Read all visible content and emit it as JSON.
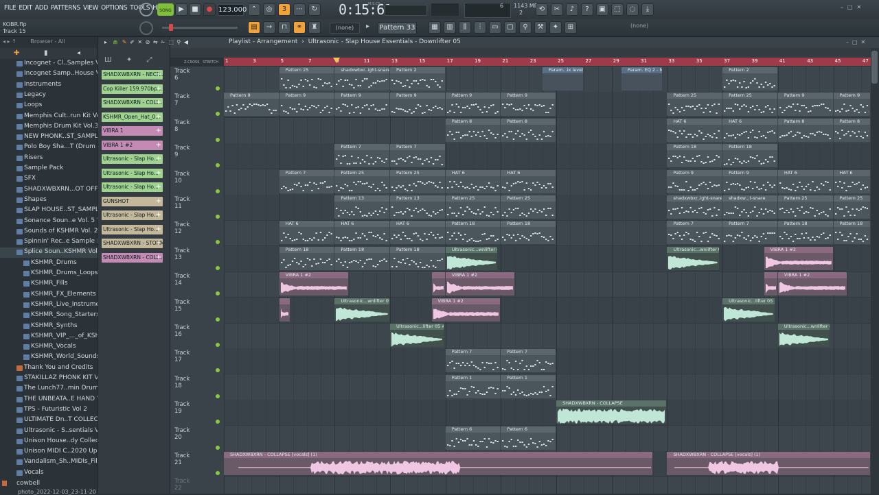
{
  "menu": [
    "FILE",
    "EDIT",
    "ADD",
    "PATTERNS",
    "VIEW",
    "OPTIONS",
    "TOOLS",
    "HELP"
  ],
  "hint": {
    "file": "KOBR.flp",
    "track": "Track 15"
  },
  "transport": {
    "song_label": "SONG",
    "tempo": "123.000",
    "time": "0:15:61",
    "time_unit": "M:S:CS",
    "cpu": "6",
    "mem": "1143 MB",
    "mem2": "2"
  },
  "pattern_selector": "Pattern 33",
  "snap_none": "(none)",
  "snap_none2": "(none)",
  "browser": {
    "header": "Browser - All",
    "items": [
      {
        "label": "Incognet - Cl..Samples Vol.1",
        "indent": 1
      },
      {
        "label": "Incognet Samp..House Vol.3",
        "indent": 1
      },
      {
        "label": "Instruments",
        "indent": 1
      },
      {
        "label": "Legacy",
        "indent": 1
      },
      {
        "label": "Loops",
        "indent": 1
      },
      {
        "label": "Memphis Cult..run Kit Vol.2",
        "indent": 1
      },
      {
        "label": "Memphis Drum Kit Vol.3",
        "indent": 1
      },
      {
        "label": "NEW PHONK..ST_SAMPLES)",
        "indent": 1
      },
      {
        "label": "Polo Boy Sha...T (Drum Kit)",
        "indent": 1
      },
      {
        "label": "Risers",
        "indent": 1
      },
      {
        "label": "Sample Pack",
        "indent": 1
      },
      {
        "label": "SFX",
        "indent": 1
      },
      {
        "label": "SHADXWBXRN...OT OFFICAL)",
        "indent": 1
      },
      {
        "label": "Shapes",
        "indent": 1
      },
      {
        "label": "SLAP HOUSE..ST_SAMPLES)",
        "indent": 1
      },
      {
        "label": "Sonance Soun..e Vol. 5 WAV",
        "indent": 1
      },
      {
        "label": "Sounds of KSHMR Vol. 2",
        "indent": 1
      },
      {
        "label": "Spinnin' Rec..e Sample Pack",
        "indent": 1
      },
      {
        "label": "Splice Soun..KSHMR Vol.3",
        "indent": 1,
        "selected": true
      },
      {
        "label": "KSHMR_Drums",
        "indent": 2
      },
      {
        "label": "KSHMR_Drums_Loops",
        "indent": 2
      },
      {
        "label": "KSHMR_Fills",
        "indent": 2
      },
      {
        "label": "KSHMR_FX_Elements",
        "indent": 2
      },
      {
        "label": "KSHMR_Live_Instruments",
        "indent": 2
      },
      {
        "label": "KSHMR_Song_Starters",
        "indent": 2
      },
      {
        "label": "KSHMR_Synths",
        "indent": 2
      },
      {
        "label": "KSHMR_VIP_..._of_KSHMR",
        "indent": 2
      },
      {
        "label": "KSHMR_Vocals",
        "indent": 2
      },
      {
        "label": "KSHMR_World_Sounds",
        "indent": 2
      },
      {
        "label": "Thank You and Credits",
        "indent": 1,
        "special": true
      },
      {
        "label": "STAKILLAZ PHONK KIT VOL.2",
        "indent": 1
      },
      {
        "label": "The Lunch77..min Drumkit",
        "indent": 1
      },
      {
        "label": "THE UNBEATA..E HAND VOL.3",
        "indent": 1
      },
      {
        "label": "TPS - Futuristic Vol 2",
        "indent": 1
      },
      {
        "label": "ULTIMATE Dn..T COLLECTION",
        "indent": 1
      },
      {
        "label": "Ultrasonic - S..sentials Vol.1",
        "indent": 1
      },
      {
        "label": "Unison House..dy Collection",
        "indent": 1
      },
      {
        "label": "Unison MIDI C..2020 Update",
        "indent": 1
      },
      {
        "label": "Vandalism_Sh..MIDIs_Files)",
        "indent": 1
      },
      {
        "label": "Vocals",
        "indent": 1
      }
    ],
    "bottom_file": "cowbell",
    "bottom_file2": "photo_2022-12-03_23-11-20"
  },
  "channels": [
    {
      "label": "SHADXWBXRN - NECR...",
      "color": "#9fd28f"
    },
    {
      "label": "Cop Killer 159.970bp...",
      "color": "#9fd28f"
    },
    {
      "label": "SHADXWBXRN - COLL...",
      "color": "#9fd28f"
    },
    {
      "label": "KSHMR_Open_Hat_0...",
      "color": "#9fd28f"
    },
    {
      "label": "VIBRA 1",
      "color": "#c38ab3"
    },
    {
      "label": "VIBRA 1 #2",
      "color": "#c38ab3"
    },
    {
      "label": "Ultrasonic - Slap Ho...",
      "color": "#9fd28f"
    },
    {
      "label": "Ultrasonic - Slap Ho...",
      "color": "#9fd28f"
    },
    {
      "label": "Ultrasonic - Slap Ho...",
      "color": "#9fd28f"
    },
    {
      "label": "GUNSHOT",
      "color": "#c4b89a"
    },
    {
      "label": "Ultrasonic - Slap Ho...",
      "color": "#c4b89a"
    },
    {
      "label": "Ultrasonic - Slap Ho...",
      "color": "#c4b89a"
    },
    {
      "label": "SHADXWBXRN - STORM",
      "color": "#c4b89a"
    },
    {
      "label": "SHADXWBXRN - COLL...",
      "color": "#c38ab3"
    }
  ],
  "playlist": {
    "title": "Playlist - Arrangement",
    "sep": "›",
    "path1": "Ultrasonic - Slap House Essentials - Downlifter 05",
    "ruler_numbers": [
      "1",
      "3",
      "5",
      "7",
      "9",
      "11",
      "13",
      "15",
      "17",
      "19",
      "21",
      "23",
      "25",
      "27",
      "29",
      "31",
      "33",
      "35",
      "37",
      "39",
      "41",
      "43",
      "45",
      "47"
    ],
    "tracks": [
      "Track 6",
      "Track 7",
      "Track 8",
      "Track 9",
      "Track 10",
      "Track 11",
      "Track 12",
      "Track 13",
      "Track 14",
      "Track 15",
      "Track 16",
      "Track 17",
      "Track 18",
      "Track 19",
      "Track 20",
      "Track 21",
      "Track 22"
    ]
  },
  "clips": [
    {
      "row": 0,
      "bar": 5,
      "len": 4,
      "type": "pat",
      "label": "Pattern 25"
    },
    {
      "row": 0,
      "bar": 9,
      "len": 4,
      "type": "pat",
      "label": "shadxwbxr..ight-snare"
    },
    {
      "row": 0,
      "bar": 13,
      "len": 4,
      "type": "pat",
      "label": "Pattern 2"
    },
    {
      "row": 0,
      "bar": 24,
      "len": 3,
      "type": "blue",
      "label": "Param...ix level"
    },
    {
      "row": 0,
      "bar": 29.7,
      "len": 3,
      "type": "blue",
      "label": "Param. EQ 2 - Mix level"
    },
    {
      "row": 0,
      "bar": 37,
      "len": 4,
      "type": "pat",
      "label": "Pattern 2"
    },
    {
      "row": 1,
      "bar": 1,
      "len": 4,
      "type": "pat",
      "label": "Pattern 9"
    },
    {
      "row": 1,
      "bar": 5,
      "len": 4,
      "type": "pat",
      "label": "Pattern 9"
    },
    {
      "row": 1,
      "bar": 9,
      "len": 4,
      "type": "pat",
      "label": "Pattern 9"
    },
    {
      "row": 1,
      "bar": 13,
      "len": 4,
      "type": "pat",
      "label": "Pattern 9"
    },
    {
      "row": 1,
      "bar": 17,
      "len": 4,
      "type": "pat",
      "label": "Pattern 9"
    },
    {
      "row": 1,
      "bar": 21,
      "len": 4,
      "type": "pat",
      "label": "Pattern 9"
    },
    {
      "row": 1,
      "bar": 33,
      "len": 4,
      "type": "pat",
      "label": "Pattern 25"
    },
    {
      "row": 1,
      "bar": 37,
      "len": 4,
      "type": "pat",
      "label": "Pattern 25"
    },
    {
      "row": 1,
      "bar": 41,
      "len": 4,
      "type": "pat",
      "label": "Pattern 9"
    },
    {
      "row": 1,
      "bar": 45,
      "len": 2.7,
      "type": "pat",
      "label": "Pattern 9"
    },
    {
      "row": 2,
      "bar": 17,
      "len": 4,
      "type": "pat",
      "label": "Pattern 8"
    },
    {
      "row": 2,
      "bar": 21,
      "len": 4,
      "type": "pat",
      "label": "Pattern 8"
    },
    {
      "row": 2,
      "bar": 33,
      "len": 4,
      "type": "pat",
      "label": "HAT 6"
    },
    {
      "row": 2,
      "bar": 37,
      "len": 4,
      "type": "pat",
      "label": "HAT 6"
    },
    {
      "row": 2,
      "bar": 41,
      "len": 4,
      "type": "pat",
      "label": "Pattern 8"
    },
    {
      "row": 2,
      "bar": 45,
      "len": 2.7,
      "type": "pat",
      "label": "Pattern 8"
    },
    {
      "row": 3,
      "bar": 9,
      "len": 4,
      "type": "pat",
      "label": "Pattern 7"
    },
    {
      "row": 3,
      "bar": 13,
      "len": 4,
      "type": "pat",
      "label": "Pattern 7"
    },
    {
      "row": 3,
      "bar": 33,
      "len": 4,
      "type": "pat",
      "label": "Pattern 18"
    },
    {
      "row": 3,
      "bar": 37,
      "len": 4,
      "type": "pat",
      "label": "Pattern 18"
    },
    {
      "row": 4,
      "bar": 5,
      "len": 4,
      "type": "pat",
      "label": "Pattern 7"
    },
    {
      "row": 4,
      "bar": 9,
      "len": 4,
      "type": "pat",
      "label": "Pattern 25"
    },
    {
      "row": 4,
      "bar": 13,
      "len": 4,
      "type": "pat",
      "label": "Pattern 25"
    },
    {
      "row": 4,
      "bar": 17,
      "len": 4,
      "type": "pat",
      "label": "HAT 6"
    },
    {
      "row": 4,
      "bar": 21,
      "len": 4,
      "type": "pat",
      "label": "HAT 6"
    },
    {
      "row": 4,
      "bar": 33,
      "len": 4,
      "type": "pat",
      "label": "Pattern 9"
    },
    {
      "row": 4,
      "bar": 37,
      "len": 4,
      "type": "pat",
      "label": "Pattern 9"
    },
    {
      "row": 4,
      "bar": 41,
      "len": 4,
      "type": "pat",
      "label": "HAT 6"
    },
    {
      "row": 4,
      "bar": 45,
      "len": 2.7,
      "type": "pat",
      "label": "HAT 6"
    },
    {
      "row": 5,
      "bar": 9,
      "len": 4,
      "type": "pat",
      "label": "Pattern 13"
    },
    {
      "row": 5,
      "bar": 13,
      "len": 4,
      "type": "pat",
      "label": "Pattern 13"
    },
    {
      "row": 5,
      "bar": 17,
      "len": 4,
      "type": "pat",
      "label": "Pattern 25"
    },
    {
      "row": 5,
      "bar": 21,
      "len": 4,
      "type": "pat",
      "label": "Pattern 25"
    },
    {
      "row": 5,
      "bar": 33,
      "len": 4,
      "type": "pat",
      "label": "shadxwbxr..ight-snare"
    },
    {
      "row": 5,
      "bar": 37,
      "len": 4,
      "type": "pat",
      "label": "shadxw...t-snare"
    },
    {
      "row": 5,
      "bar": 41,
      "len": 4,
      "type": "pat",
      "label": "Pattern 25"
    },
    {
      "row": 5,
      "bar": 45,
      "len": 2.7,
      "type": "pat",
      "label": "Pattern 25"
    },
    {
      "row": 6,
      "bar": 5,
      "len": 4,
      "type": "pat",
      "label": "HAT 6"
    },
    {
      "row": 6,
      "bar": 9,
      "len": 4,
      "type": "pat",
      "label": "HAT 6"
    },
    {
      "row": 6,
      "bar": 13,
      "len": 4,
      "type": "pat",
      "label": "HAT 6"
    },
    {
      "row": 6,
      "bar": 17,
      "len": 4,
      "type": "pat",
      "label": "Pattern 18"
    },
    {
      "row": 6,
      "bar": 21,
      "len": 4,
      "type": "pat",
      "label": "Pattern 18"
    },
    {
      "row": 6,
      "bar": 33,
      "len": 4,
      "type": "pat",
      "label": "Pattern 7"
    },
    {
      "row": 6,
      "bar": 37,
      "len": 4,
      "type": "pat",
      "label": "Pattern 7"
    },
    {
      "row": 6,
      "bar": 41,
      "len": 4,
      "type": "pat",
      "label": "Pattern 18"
    },
    {
      "row": 6,
      "bar": 45,
      "len": 2.7,
      "type": "pat",
      "label": "Pattern 18"
    },
    {
      "row": 7,
      "bar": 5,
      "len": 4,
      "type": "pat",
      "label": "Pattern 18"
    },
    {
      "row": 7,
      "bar": 9,
      "len": 4,
      "type": "pat",
      "label": "Pattern 18"
    },
    {
      "row": 7,
      "bar": 13,
      "len": 4,
      "type": "pat",
      "label": "Pattern 18"
    },
    {
      "row": 7,
      "bar": 17,
      "len": 3.8,
      "type": "green",
      "label": "Ultrasonic...wnlifter 05"
    },
    {
      "row": 7,
      "bar": 33,
      "len": 3.8,
      "type": "green",
      "label": "Ultrasonic...wnlifter 05"
    },
    {
      "row": 7,
      "bar": 40,
      "len": 5,
      "type": "pink",
      "label": "VIBRA 1 #2"
    },
    {
      "row": 8,
      "bar": 5,
      "len": 5,
      "type": "pink",
      "label": "VIBRA 1 #2"
    },
    {
      "row": 8,
      "bar": 16,
      "len": 1,
      "type": "pink",
      "label": ""
    },
    {
      "row": 8,
      "bar": 17,
      "len": 5,
      "type": "pink",
      "label": "VIBRA 1 #2"
    },
    {
      "row": 8,
      "bar": 40,
      "len": 1,
      "type": "pink",
      "label": ""
    },
    {
      "row": 8,
      "bar": 41,
      "len": 5,
      "type": "pink",
      "label": "VIBRA 1 #2"
    },
    {
      "row": 9,
      "bar": 5,
      "len": 0.8,
      "type": "pink",
      "label": ""
    },
    {
      "row": 9,
      "bar": 9,
      "len": 4,
      "type": "green",
      "label": "Ultrasonic...wnlifter 05"
    },
    {
      "row": 9,
      "bar": 16,
      "len": 5,
      "type": "pink",
      "label": "VIBRA 1 #2"
    },
    {
      "row": 9,
      "bar": 37,
      "len": 3.8,
      "type": "green",
      "label": "Ultrasonic...lifter 05 #2"
    },
    {
      "row": 10,
      "bar": 13,
      "len": 3.9,
      "type": "green",
      "label": "Ultrasonic...lifter 05 #2"
    },
    {
      "row": 10,
      "bar": 41,
      "len": 3.8,
      "type": "green",
      "label": "Ultrasonic...wnlifter 05"
    },
    {
      "row": 11,
      "bar": 17,
      "len": 4,
      "type": "pat",
      "label": "Pattern 7"
    },
    {
      "row": 11,
      "bar": 21,
      "len": 4,
      "type": "pat",
      "label": "Pattern 7"
    },
    {
      "row": 12,
      "bar": 17,
      "len": 4,
      "type": "pat",
      "label": "Pattern 1"
    },
    {
      "row": 12,
      "bar": 21,
      "len": 4,
      "type": "pat",
      "label": "Pattern 1"
    },
    {
      "row": 13,
      "bar": 25,
      "len": 8,
      "type": "green",
      "label": "SHADXWBXRN - COLLAPSE"
    },
    {
      "row": 14,
      "bar": 17,
      "len": 4,
      "type": "pat",
      "label": "Pattern 6"
    },
    {
      "row": 14,
      "bar": 21,
      "len": 4,
      "type": "pat",
      "label": "Pattern 6"
    },
    {
      "row": 15,
      "bar": 1,
      "len": 31,
      "type": "pink",
      "label": "SHADXWBXRN - COLLAPSE [vocals] (1)"
    },
    {
      "row": 15,
      "bar": 33,
      "len": 14.7,
      "type": "pink",
      "label": "SHADXWBXRN - COLLAPSE [vocals] (1)"
    }
  ],
  "colors": {
    "accent": "#f1a23b",
    "ruler": "#9e3b4a",
    "green_led": "#8acb3c",
    "song": "#7fbf3a"
  }
}
